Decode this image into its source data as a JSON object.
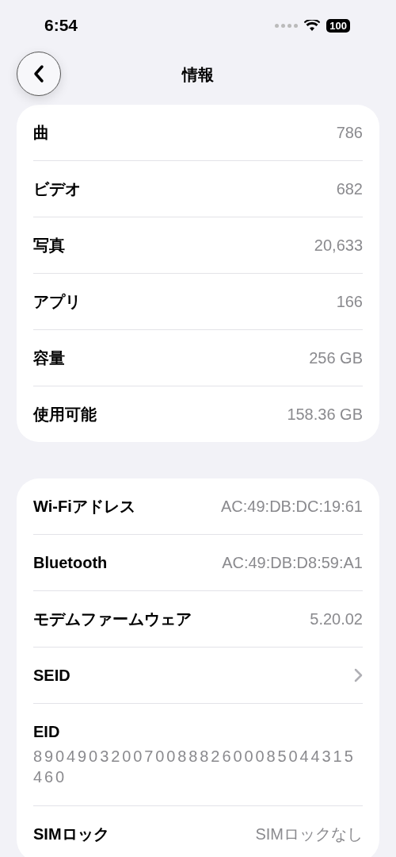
{
  "status_bar": {
    "time": "6:54",
    "battery": "100"
  },
  "nav": {
    "title": "情報"
  },
  "sections": [
    {
      "rows": [
        {
          "kind": "value",
          "label": "曲",
          "value": "786"
        },
        {
          "kind": "value",
          "label": "ビデオ",
          "value": "682"
        },
        {
          "kind": "value",
          "label": "写真",
          "value": "20,633"
        },
        {
          "kind": "value",
          "label": "アプリ",
          "value": "166"
        },
        {
          "kind": "value",
          "label": "容量",
          "value": "256 GB"
        },
        {
          "kind": "value",
          "label": "使用可能",
          "value": "158.36 GB"
        }
      ]
    },
    {
      "rows": [
        {
          "kind": "value",
          "label": "Wi-Fiアドレス",
          "value": "AC:49:DB:DC:19:61"
        },
        {
          "kind": "value",
          "label": "Bluetooth",
          "value": "AC:49:DB:D8:59:A1"
        },
        {
          "kind": "value",
          "label": "モデムファームウェア",
          "value": "5.20.02"
        },
        {
          "kind": "link",
          "label": "SEID"
        },
        {
          "kind": "stacked",
          "label": "EID",
          "value": "89049032007008882600085044315460"
        },
        {
          "kind": "value",
          "label": "SIMロック",
          "value": "SIMロックなし"
        }
      ]
    }
  ]
}
